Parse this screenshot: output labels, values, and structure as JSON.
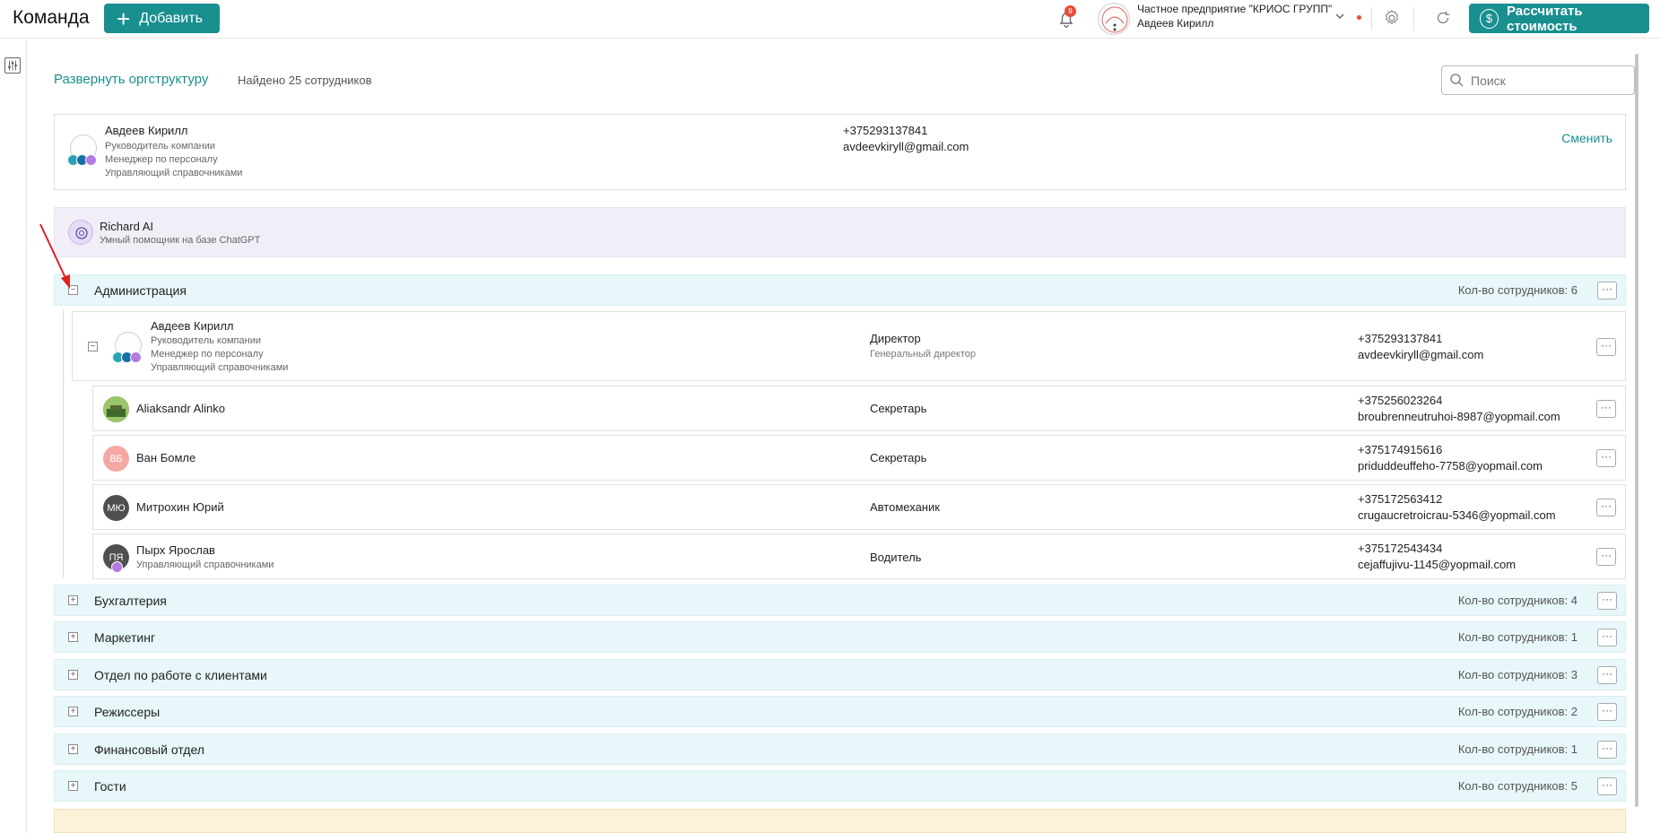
{
  "header": {
    "title": "Команда",
    "add_label": "Добавить",
    "notifications_count": "9",
    "org_name": "Частное предприятие \"КРИОС ГРУПП\"",
    "org_user": "Авдеев Кирилл",
    "calc_label": "Рассчитать стоимость"
  },
  "toolbar": {
    "expand_label": "Развернуть оргструктуру",
    "found_text": "Найдено 25 сотрудников",
    "search_placeholder": "Поиск"
  },
  "owner": {
    "name": "Авдеев Кирилл",
    "roles": [
      "Руководитель компании",
      "Менеджер по персоналу",
      "Управляющий справочниками"
    ],
    "phone": "+375293137841",
    "email": "avdeevkiryll@gmail.com",
    "change_label": "Сменить"
  },
  "assistant": {
    "name": "Richard AI",
    "description": "Умный помощник на базе ChatGPT"
  },
  "departments": [
    {
      "name": "Администрация",
      "count": "Кол-во сотрудников: 6",
      "toggle": "−"
    },
    {
      "name": "Бухгалтерия",
      "count": "Кол-во сотрудников: 4",
      "toggle": "+"
    },
    {
      "name": "Маркетинг",
      "count": "Кол-во сотрудников: 1",
      "toggle": "+"
    },
    {
      "name": "Отдел по работе с клиентами",
      "count": "Кол-во сотрудников: 3",
      "toggle": "+"
    },
    {
      "name": "Режиссеры",
      "count": "Кол-во сотрудников: 2",
      "toggle": "+"
    },
    {
      "name": "Финансовый отдел",
      "count": "Кол-во сотрудников: 1",
      "toggle": "+"
    },
    {
      "name": "Гости",
      "count": "Кол-во сотрудников: 5",
      "toggle": "+"
    }
  ],
  "admin_members": [
    {
      "name": "Авдеев Кирилл",
      "roles": [
        "Руководитель компании",
        "Менеджер по персоналу",
        "Управляющий справочниками"
      ],
      "position": "Директор",
      "position_sub": "Генеральный директор",
      "phone": "+375293137841",
      "email": "avdeevkiryll@gmail.com"
    },
    {
      "name": "Aliaksandr Alinko",
      "initials": "",
      "position": "Секретарь",
      "phone": "+375256023264",
      "email": "broubrenneutruhoi-8987@yopmail.com"
    },
    {
      "name": "Ван Бомле",
      "initials": "ВБ",
      "position": "Секретарь",
      "phone": "+375174915616",
      "email": "priduddeuffeho-7758@yopmail.com"
    },
    {
      "name": "Митрохин Юрий",
      "initials": "МЮ",
      "position": "Автомеханик",
      "phone": "+375172563412",
      "email": "crugaucretroicrau-5346@yopmail.com"
    },
    {
      "name": "Пырх Ярослав",
      "initials": "ПЯ",
      "sub": "Управляющий справочниками",
      "position": "Водитель",
      "phone": "+375172543434",
      "email": "cejaffujivu-1145@yopmail.com"
    }
  ],
  "more_label": "···",
  "colors": {
    "accent": "#1a8f8f",
    "dept_bg": "#e8f7f9",
    "ai_bg": "#f1eef7",
    "badge": "#e74c3c"
  }
}
